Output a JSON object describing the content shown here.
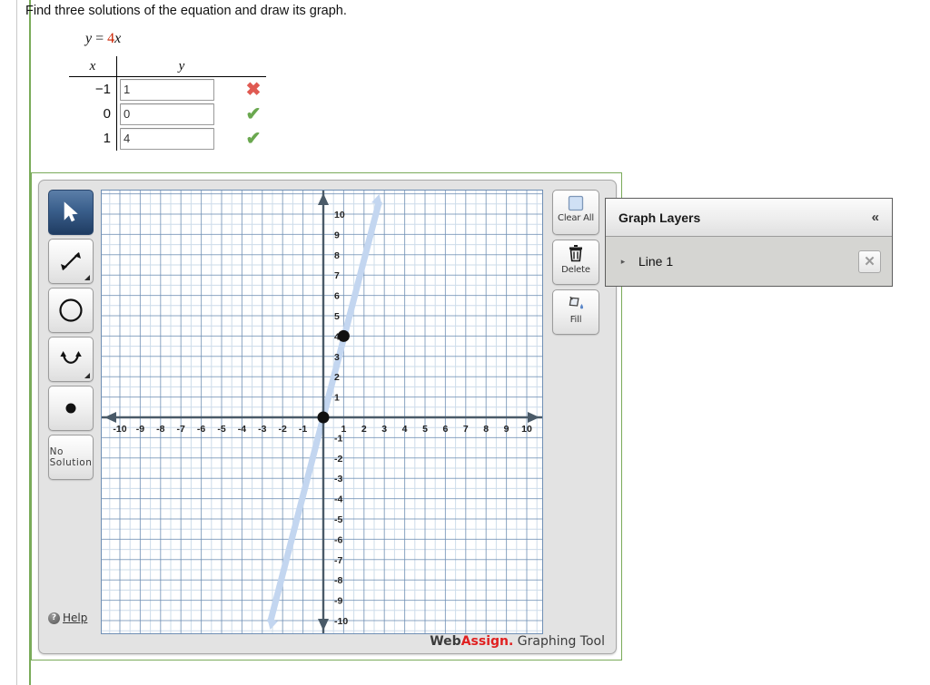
{
  "question": "Find three solutions of the equation and draw its graph.",
  "equation": {
    "lhs": "y",
    "eq": "=",
    "coef": "4",
    "rhs_var": "x"
  },
  "table": {
    "header_x": "x",
    "header_y": "y",
    "rows": [
      {
        "x": "−1",
        "y_value": "1",
        "mark": "✖",
        "mark_kind": "incorrect"
      },
      {
        "x": "0",
        "y_value": "0",
        "mark": "✔",
        "mark_kind": "correct"
      },
      {
        "x": "1",
        "y_value": "4",
        "mark": "✔",
        "mark_kind": "correct"
      }
    ],
    "placeholder": ""
  },
  "tools": {
    "left": [
      {
        "name": "select-tool",
        "icon": "arrow-cursor-icon",
        "label": "",
        "selected": true,
        "has_corner": false
      },
      {
        "name": "line-tool",
        "icon": "double-arrow-icon",
        "label": "",
        "selected": false,
        "has_corner": true
      },
      {
        "name": "circle-tool",
        "icon": "circle-icon",
        "label": "",
        "selected": false,
        "has_corner": false
      },
      {
        "name": "parabola-tool",
        "icon": "parabola-icon",
        "label": "",
        "selected": false,
        "has_corner": true
      },
      {
        "name": "point-tool",
        "icon": "dot-icon",
        "label": "",
        "selected": false,
        "has_corner": false
      },
      {
        "name": "no-solution-tool",
        "icon": "text-icon",
        "label": "No Solution",
        "selected": false,
        "has_corner": false
      }
    ],
    "right": [
      {
        "name": "clear-all-button",
        "icon": "square-icon",
        "label": "Clear All"
      },
      {
        "name": "delete-button",
        "icon": "trash-icon",
        "label": "Delete"
      },
      {
        "name": "fill-button",
        "icon": "paint-bucket-icon",
        "label": "Fill"
      }
    ],
    "help_label": "Help",
    "help_icon": "question-circle-icon"
  },
  "brand": {
    "web": "Web",
    "assign": "Assign.",
    "tool": " Graphing Tool"
  },
  "layers": {
    "title": "Graph Layers",
    "collapse_icon": "«",
    "items": [
      {
        "expand_icon": "▸",
        "label": "Line 1",
        "close_icon": "✕"
      }
    ]
  },
  "colors": {
    "accent_green": "#7aab5a",
    "grid_major": "#6f8fb5",
    "grid_minor": "#cddcea",
    "axis": "#4a5a68",
    "line": "#c3d6f0",
    "mark_correct": "#6aa84f",
    "mark_incorrect": "#e05a52",
    "brand_red": "#e02020",
    "selected_tool": "#1f3c62"
  },
  "chart_data": {
    "type": "line",
    "title": "",
    "xlabel": "",
    "ylabel": "",
    "xlim": [
      -10.8,
      10.8
    ],
    "ylim": [
      -10.8,
      10.8
    ],
    "grid": true,
    "minor_grid": true,
    "major_step": 1,
    "minor_step": 0.5,
    "xticks": [
      -10,
      -9,
      -8,
      -7,
      -6,
      -5,
      -4,
      -3,
      -2,
      -1,
      1,
      2,
      3,
      4,
      5,
      6,
      7,
      8,
      9,
      10
    ],
    "yticks": [
      10,
      9,
      8,
      7,
      6,
      5,
      4,
      3,
      2,
      1,
      -1,
      -2,
      -3,
      -4,
      -5,
      -6,
      -7,
      -8,
      -9,
      -10
    ],
    "series": [
      {
        "name": "Line 1",
        "equation": "y = 4x",
        "slope": 4,
        "intercept": 0,
        "color": "#c3d6f0",
        "points": [
          {
            "x": 0,
            "y": 0,
            "style": "filled-dot"
          },
          {
            "x": 1,
            "y": 4,
            "style": "filled-dot"
          }
        ],
        "arrowheads": [
          "start",
          "end"
        ]
      }
    ]
  }
}
